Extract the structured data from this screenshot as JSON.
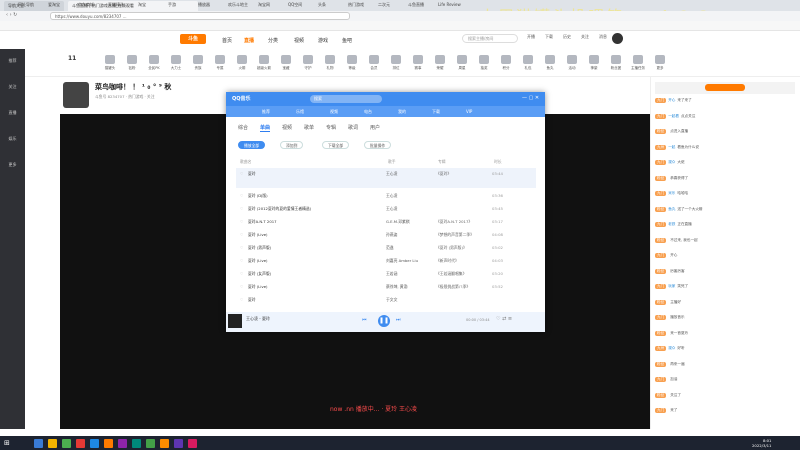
{
  "browser": {
    "tabs": [
      "导航大全",
      "斗鱼直播 | 热门游戏直播_在线观看"
    ],
    "url": "https://www.douyu.com/8234707  ...",
    "bookmarks": [
      "网址导航",
      "爱淘宝",
      "京东商城",
      "天猫精选",
      "淘宝",
      "手游",
      "播放器",
      "欢乐斗地主",
      "淘宝网",
      "QQ空间",
      "头条",
      "热门游戏",
      "二次元",
      "斗鱼直播",
      "Life Review"
    ],
    "overlay": "上周猫罐头投喂第一：1 2 3"
  },
  "site": {
    "logo": "斗鱼",
    "nav": [
      "首页",
      "直播",
      "分类",
      "视频",
      "游戏",
      "鱼吧"
    ],
    "search_placeholder": "搜索主播/房间",
    "header_icons": [
      "开播",
      "下载",
      "历史",
      "关注",
      "消息",
      "设置"
    ]
  },
  "leftrail": [
    "推荐",
    "关注",
    "直播",
    "娱乐",
    "更多"
  ],
  "activity": {
    "date": "11",
    "items": [
      "猫罐头",
      "钻粉",
      "全民PK",
      "大力士",
      "贵族",
      "专属",
      "火箭",
      "超级火箭",
      "宝藏",
      "守护",
      "礼物",
      "等级",
      "会员",
      "排位",
      "赛事",
      "荣耀",
      "周星",
      "抽奖",
      "积分",
      "礼包",
      "鱼丸",
      "活动",
      "神豪",
      "粉丝团",
      "主播任务",
      "更多"
    ]
  },
  "room": {
    "title": "菜鸟咖啡！ ！ ¹ ₀ ° ⁹ 秋",
    "subtitle": "斗鱼号 8234707 · 热门游戏 · 关注"
  },
  "music": {
    "title": "QQ音乐",
    "search": "搜索",
    "tabs": [
      "推荐",
      "乐馆",
      "视频",
      "电台",
      "我的",
      "下载",
      "VIP"
    ],
    "categories": [
      "综合",
      "单曲",
      "视频",
      "歌单",
      "专辑",
      "歌词",
      "用户"
    ],
    "buttons": [
      "播放全部",
      "添加到",
      "下载全部",
      "批量操作"
    ],
    "columns": [
      "歌曲名",
      "歌手",
      "专辑",
      "时长"
    ],
    "rows": [
      {
        "title": "夏玲",
        "artist": "王心凌",
        "album": "《夏玲》",
        "duration": "03:44"
      },
      {
        "title": "夏玲 (DJ版)",
        "artist": "王心凌",
        "album": "",
        "duration": "03:36"
      },
      {
        "title": "夏玲 (2012夏玲的夏的爱情王者精选)",
        "artist": "王心凌",
        "album": "",
        "duration": "03:45"
      },
      {
        "title": "夏玲A.N.T 2017",
        "artist": "G.E.M.邓紫棋",
        "album": "《夏玲A.N.T 2017》",
        "duration": "03:17"
      },
      {
        "title": "夏玲 (Live)",
        "artist": "孙燕姿",
        "album": "《梦想的声音第二季》",
        "duration": "04:08"
      },
      {
        "title": "夏玲 (男声版)",
        "artist": "范逸",
        "album": "《夏玲 (男声版)》",
        "duration": "03:02"
      },
      {
        "title": "夏玲 (Live)",
        "artist": "刘嘉亮 Amber Liu",
        "album": "《新声时代》",
        "duration": "04:03"
      },
      {
        "title": "夏玲 (女声版)",
        "artist": "王若涵",
        "album": "《王若涵翻唱集》",
        "duration": "03:20"
      },
      {
        "title": "夏玲 (Live)",
        "artist": "蔡徐坤, 黄渤",
        "album": "《极限挑战第八季》",
        "duration": "03:52"
      },
      {
        "title": "夏玲",
        "artist": "于文文",
        "album": "",
        "duration": ""
      }
    ],
    "now_playing": "王心凌 - 夏玲",
    "time": "00:00 / 03:44"
  },
  "bottom_text": "now .nn 播放中... · 夏玲 王心凌",
  "chat": [
    {
      "badge": "九门",
      "user": "开心",
      "msg": "来了来了"
    },
    {
      "badge": "九门",
      "user": "一起看",
      "msg": "点点关注"
    },
    {
      "badge": "粉丝",
      "user": "",
      "msg": "点进入直播"
    },
    {
      "badge": "九州",
      "user": "一起",
      "msg": "看鱼为什么说"
    },
    {
      "badge": "九门",
      "user": "观众",
      "msg": "大佬"
    },
    {
      "badge": "粉丝",
      "user": "",
      "msg": "恭喜获得了"
    },
    {
      "badge": "九门",
      "user": "米乐",
      "msg": "哈哈哈"
    },
    {
      "badge": "粉丝",
      "user": "鱼丸",
      "msg": "送了一个大火箭"
    },
    {
      "badge": "九门",
      "user": "老铁",
      "msg": "正在直播"
    },
    {
      "badge": "粉丝",
      "user": "",
      "msg": "不过来, 我也一起"
    },
    {
      "badge": "九门",
      "user": "",
      "msg": "开心"
    },
    {
      "badge": "粉丝",
      "user": "",
      "msg": "厉害厉害"
    },
    {
      "badge": "九门",
      "user": "玩家",
      "msg": "笑死了"
    },
    {
      "badge": "粉丝",
      "user": "",
      "msg": "主播好"
    },
    {
      "badge": "九门",
      "user": "",
      "msg": "播放音乐"
    },
    {
      "badge": "粉丝",
      "user": "",
      "msg": "来一首夏玲"
    },
    {
      "badge": "九州",
      "user": "观众",
      "msg": "好听"
    },
    {
      "badge": "粉丝",
      "user": "",
      "msg": "再来一遍"
    },
    {
      "badge": "九门",
      "user": "",
      "msg": "加油"
    },
    {
      "badge": "粉丝",
      "user": "",
      "msg": "关注了"
    },
    {
      "badge": "九门",
      "user": "",
      "msg": "来了"
    }
  ],
  "taskbar": {
    "time": "8:01",
    "date": "2022/3/11"
  },
  "colors": {
    "accent": "#ff7a00",
    "music_blue": "#3f8cf0",
    "rail": "#2f3035",
    "player": "#111111"
  }
}
